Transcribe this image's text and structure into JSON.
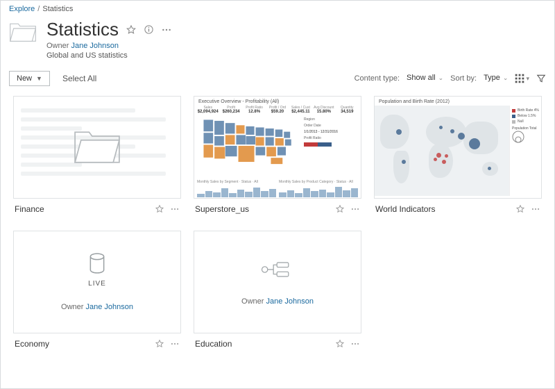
{
  "breadcrumb": {
    "root": "Explore",
    "current": "Statistics"
  },
  "header": {
    "title": "Statistics",
    "owner_label": "Owner",
    "owner_name": "Jane Johnson",
    "description": "Global and US statistics"
  },
  "toolbar": {
    "new_label": "New",
    "select_all": "Select All",
    "content_type_label": "Content type:",
    "content_type_value": "Show all",
    "sort_by_label": "Sort by:",
    "sort_by_value": "Type"
  },
  "cards": {
    "finance": {
      "name": "Finance"
    },
    "superstore": {
      "name": "Superstore_us",
      "dash_title": "Executive Overview - Profitability (All)",
      "kpis": [
        {
          "lab": "Sales",
          "val": "$2,094,924"
        },
        {
          "lab": "Profit",
          "val": "$260,234"
        },
        {
          "lab": "Profit Ratio",
          "val": "12.8%"
        },
        {
          "lab": "Profit / Ord",
          "val": "$59.20"
        },
        {
          "lab": "Sales / Cust",
          "val": "$2,445.11"
        },
        {
          "lab": "Avg Discount",
          "val": "15.80%"
        },
        {
          "lab": "Quantity",
          "val": "34,519"
        }
      ],
      "side": {
        "region": "Region",
        "order_date": "Order Date",
        "order_date_range": "1/1/2013 - 12/31/2016",
        "profit_ratio": "Profit Ratio"
      },
      "sparks": {
        "left_label": "Monthly Sales by Segment · Status · All",
        "right_label": "Monthly Sales by Product Category · Status · All"
      }
    },
    "world": {
      "name": "World Indicators",
      "title": "Population and Birth Rate (2012)",
      "legend": {
        "r": "Birth Rate 4%",
        "b": "Below 1.5%",
        "n": "Null",
        "pop": "Population Total"
      }
    },
    "economy": {
      "name": "Economy",
      "live": "LIVE",
      "owner_label": "Owner",
      "owner_name": "Jane Johnson"
    },
    "education": {
      "name": "Education",
      "owner_label": "Owner",
      "owner_name": "Jane Johnson"
    }
  }
}
